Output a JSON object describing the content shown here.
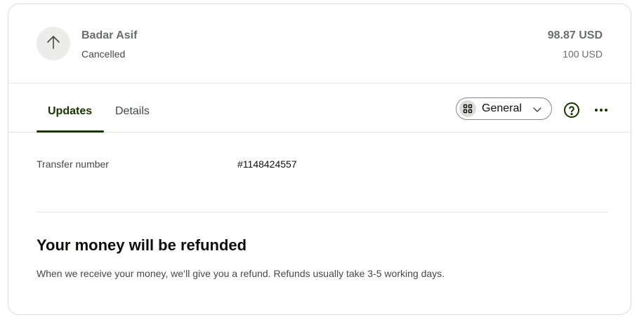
{
  "transfer": {
    "recipient_name": "Badar Asif",
    "status": "Cancelled",
    "amount": "98.87 USD",
    "amount_sent": "100 USD"
  },
  "tabs": [
    {
      "label": "Updates",
      "active": true
    },
    {
      "label": "Details",
      "active": false
    }
  ],
  "view_selector": {
    "label": "General"
  },
  "details": {
    "transfer_number_label": "Transfer number",
    "transfer_number_value": "#1148424557"
  },
  "refund": {
    "title": "Your money will be refunded",
    "text": "When we receive your money, we’ll give you a refund. Refunds usually take 3-5 working days."
  },
  "colors": {
    "accent": "#163300",
    "muted_text": "#6a6c6a",
    "border": "#dcdcda"
  },
  "icons": {
    "avatar": "arrow-up-icon",
    "view_selector": "grid-icon",
    "chevron": "chevron-down-icon",
    "help": "help-circle-icon",
    "more": "more-horizontal-icon"
  }
}
